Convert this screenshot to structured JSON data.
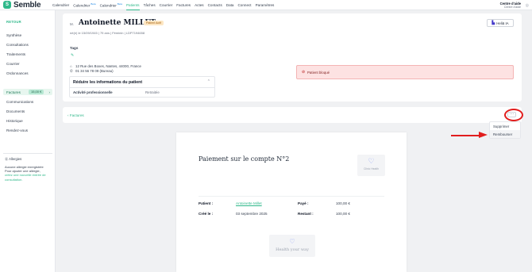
{
  "app": {
    "name": "Semble",
    "logo_glyph": "S"
  },
  "nav": {
    "items": [
      {
        "label": "Calendrier",
        "beta": ""
      },
      {
        "label": "Calendrier",
        "beta": "Beta"
      },
      {
        "label": "Calendrier",
        "beta": "Beta"
      },
      {
        "label": "Patients",
        "beta": ""
      },
      {
        "label": "Tâches",
        "beta": ""
      },
      {
        "label": "Courrier",
        "beta": ""
      },
      {
        "label": "Factures",
        "beta": ""
      },
      {
        "label": "Actes",
        "beta": ""
      },
      {
        "label": "Contacts",
        "beta": ""
      },
      {
        "label": "Data",
        "beta": ""
      },
      {
        "label": "Connect",
        "beta": ""
      },
      {
        "label": "Paramètres",
        "beta": ""
      }
    ],
    "active_index": 3,
    "center_name": "Centre d'aide",
    "center_sub": "Centre d'aide"
  },
  "sidebar": {
    "back": "RETOUR",
    "items": [
      "Synthèse",
      "Consultations",
      "Traitements",
      "Courrier",
      "Ordonnances",
      "Factures",
      "Relevés de compte",
      "Communications",
      "Documents",
      "Historique",
      "Rendez-vous"
    ],
    "active_label": "Factures",
    "active_badge": "15,00 €",
    "allergy": {
      "title": "Allergies",
      "text": "Aucune allergie enregistrée Pour ajouter une allergie,",
      "link": "créez une nouvelle entrée de consultation."
    }
  },
  "patient": {
    "prefix": "M. ",
    "name": "Antoinette MILLET",
    "status": "Patient Actif",
    "meta": "né(e) le 15/09/1945  |  79 ans  |  Féminin  |  LDP7194658",
    "helio_label": "Heliā IA",
    "tags_label": "Tags",
    "address": "12 Rue des Boxes, Nantes, 44000, France",
    "phone": "01 34 56 78 09 (Bureau)",
    "reduce_title": "Réduire les informations du patient",
    "reduce_key": "Activité professionnelle",
    "reduce_value": "Retraitée",
    "blocked_text": "Patient bloqué"
  },
  "invoice_bar": {
    "back_label": "Factures",
    "more_label": "···"
  },
  "dropdown": {
    "items": [
      "Supprimer",
      "Rembourser"
    ]
  },
  "receipt": {
    "title": "Paiement sur le compte N°2",
    "logo_text": "Clinic Health",
    "patient_label": "Patient :",
    "patient_value": "Antoinette Millet",
    "created_label": "Créé le :",
    "created_value": "03 septembre 2025",
    "paid_label": "Payé :",
    "paid_value": "100,00 €",
    "remaining_label": "Restant :",
    "remaining_value": "100,00 €",
    "footer_text": "Health your way"
  },
  "colors": {
    "accent": "#2fb88a",
    "alert_red": "#e11d1d",
    "blocked_bg": "#fde2e2"
  }
}
